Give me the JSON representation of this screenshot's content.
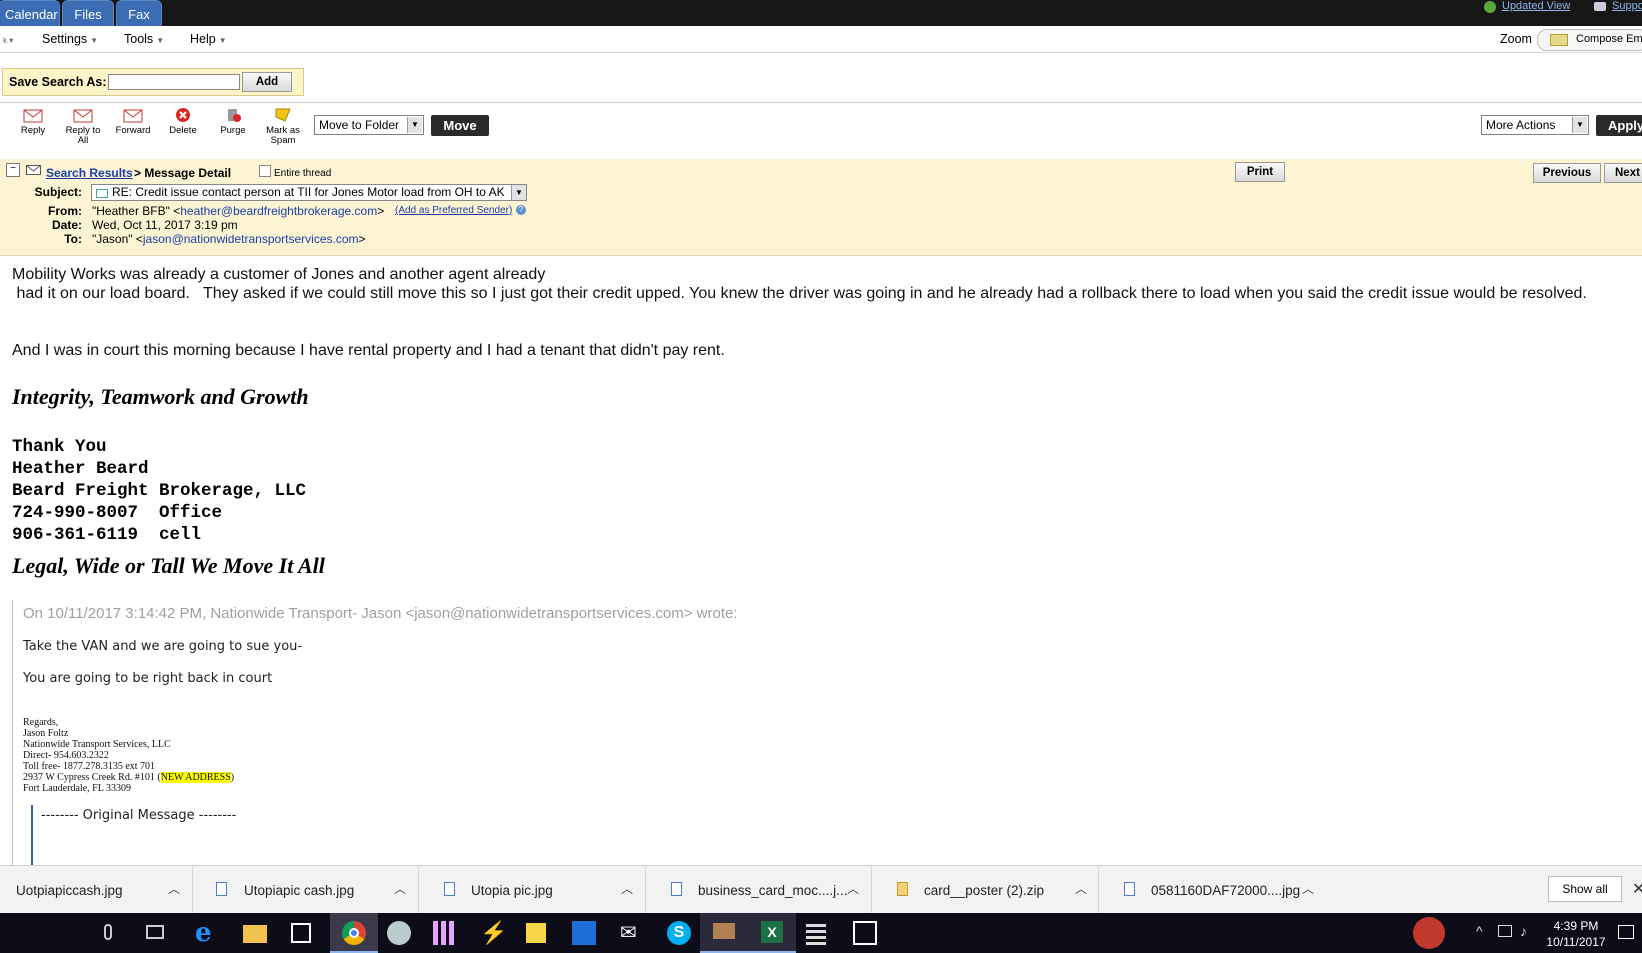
{
  "top_tabs": [
    "Calendar",
    "Files",
    "Fax"
  ],
  "top_links": {
    "updated_view": "Updated View",
    "support": "Suppo"
  },
  "menu": {
    "items": [
      "Settings",
      "Tools",
      "Help"
    ],
    "zoom": "Zoom",
    "compose": "Compose Ema"
  },
  "save_search": {
    "label": "Save Search As:",
    "value": "",
    "add": "Add"
  },
  "toolbar": {
    "buttons": [
      {
        "label": "Reply",
        "icon": "reply-icon"
      },
      {
        "label": "Reply to All",
        "icon": "reply-all-icon"
      },
      {
        "label": "Forward",
        "icon": "forward-icon"
      },
      {
        "label": "Delete",
        "icon": "delete-icon"
      },
      {
        "label": "Purge",
        "icon": "purge-icon"
      },
      {
        "label": "Mark as Spam",
        "icon": "mark-spam-icon"
      }
    ],
    "move_to_folder": "Move to Folder",
    "move": "Move",
    "more_actions": "More Actions",
    "apply": "Apply"
  },
  "message": {
    "breadcrumb_link": "Search Results",
    "breadcrumb_rest": "> Message Detail",
    "entire_thread": "Entire thread",
    "print": "Print",
    "previous": "Previous",
    "next": "Next",
    "subject_label": "Subject:",
    "subject": "RE: Credit issue contact person at TII for Jones Motor load from OH to AK",
    "from_label": "From:",
    "from_name": "\"Heather BFB\" <",
    "from_email": "heather@beardfreightbrokerage.com",
    "from_close": ">",
    "add_preferred": "(Add as Preferred Sender)",
    "date_label": "Date:",
    "date": "Wed, Oct 11, 2017 3:19 pm",
    "to_label": "To:",
    "to_name": "\"Jason\" <",
    "to_email": "jason@nationwidetransportservices.com",
    "to_close": ">"
  },
  "body": {
    "line1": "Mobility Works was already a customer of Jones and another agent already",
    "line2": " had it on our load board.   They asked if we could still move this so I just got their credit upped. You knew the driver was going in and he already had a rollback there to load when you said the credit issue would be resolved.",
    "line3": "And I was in court this morning because I have rental property and I had a tenant that didn't pay rent.",
    "motto": "Integrity, Teamwork and Growth",
    "sig": [
      "Thank You",
      "Heather Beard",
      "Beard Freight Brokerage, LLC",
      "724-990-8007  Office",
      "906-361-6119  cell"
    ],
    "tagline": "Legal, Wide or Tall We Move It All"
  },
  "quote": {
    "header": "On 10/11/2017 3:14:42 PM, Nationwide Transport- Jason <jason@nationwidetransportservices.com> wrote:",
    "line1": "Take the VAN and we are going to sue you-",
    "line2": "You are going to be right back in court",
    "sig": [
      "Regards,",
      "Jason Foltz",
      "Nationwide Transport Services, LLC",
      "Direct- 954.603.2322",
      "Toll free- 1877.278.3135 ext 701"
    ],
    "address_pre": "2937 W Cypress Creek Rd. #101 (",
    "address_hl": "NEW ADDRESS",
    "address_post": ")",
    "city": "Fort Lauderdale, FL 33309",
    "original": "-------- Original Message --------"
  },
  "downloads": {
    "items": [
      "Uotpiapiccash.jpg",
      "Utopiapic cash.jpg",
      "Utopia pic.jpg",
      "business_card_moc....j...",
      "card__poster (2).zip",
      "0581160DAF72000....jpg"
    ],
    "show_all": "Show all"
  },
  "clock": {
    "time": "4:39 PM",
    "date": "10/11/2017"
  },
  "colors": {
    "tab_blue": "#3a6db3",
    "header_bg": "#fbf3d2",
    "link": "#1a3fa8",
    "highlight": "#ffff00"
  }
}
